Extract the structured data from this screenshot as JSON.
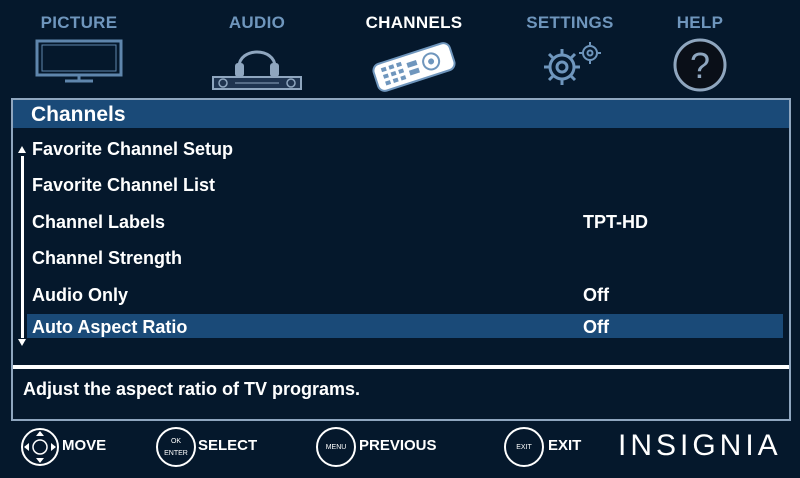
{
  "tabs": [
    {
      "label": "PICTURE",
      "icon": "tv-icon",
      "active": false
    },
    {
      "label": "AUDIO",
      "icon": "headphones-icon",
      "active": false
    },
    {
      "label": "CHANNELS",
      "icon": "remote-icon",
      "active": true
    },
    {
      "label": "SETTINGS",
      "icon": "gears-icon",
      "active": false
    },
    {
      "label": "HELP",
      "icon": "question-icon",
      "active": false
    }
  ],
  "panel": {
    "title": "Channels",
    "items": [
      {
        "label": "Favorite Channel Setup",
        "value": ""
      },
      {
        "label": "Favorite Channel List",
        "value": ""
      },
      {
        "label": "Channel Labels",
        "value": "TPT-HD"
      },
      {
        "label": "Channel Strength",
        "value": ""
      },
      {
        "label": "Audio Only",
        "value": "Off"
      },
      {
        "label": "Auto Aspect Ratio",
        "value": "Off",
        "selected": true
      }
    ],
    "help_text": "Adjust the aspect ratio of TV programs."
  },
  "bottom": {
    "move_label": "MOVE",
    "ok_label": "OK",
    "enter_label": "ENTER",
    "select_label": "SELECT",
    "menu_label": "MENU",
    "previous_label": "PREVIOUS",
    "exit_btn_label": "EXIT",
    "exit_label": "EXIT",
    "brand": "INSIGNIA"
  },
  "colors": {
    "background": "#05182c",
    "highlight": "#1a4a78",
    "inactive_tab": "#6f96bd",
    "active_tab": "#ffffff"
  }
}
